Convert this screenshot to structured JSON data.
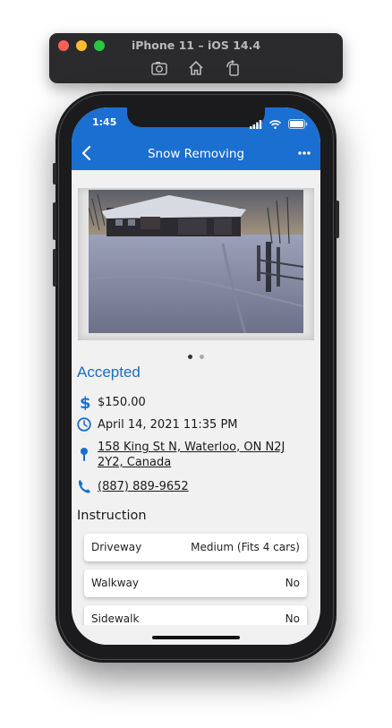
{
  "simulator": {
    "title": "iPhone 11 – iOS 14.4",
    "tools": [
      "camera-icon",
      "home-icon",
      "rotate-icon"
    ]
  },
  "status_bar": {
    "time": "1:45"
  },
  "nav": {
    "title": "Snow Removing",
    "back_icon": "chevron-left-icon",
    "more_icon": "ellipsis-icon",
    "color": "#1b6fd0"
  },
  "gallery": {
    "image": "snowy house with driveway photo",
    "pages": 2,
    "active_page": 1
  },
  "job": {
    "status": "Accepted",
    "status_color": "#1b6fb8",
    "price": "$150.00",
    "datetime": "April 14, 2021 11:35 PM",
    "address": "158 King St N, Waterloo, ON N2J 2Y2, Canada",
    "phone": "(887) 889-9652"
  },
  "instructions": {
    "title": "Instruction",
    "items": [
      {
        "label": "Driveway",
        "value": "Medium (Fits 4 cars)"
      },
      {
        "label": "Walkway",
        "value": "No"
      },
      {
        "label": "Sidewalk",
        "value": "No"
      }
    ]
  }
}
